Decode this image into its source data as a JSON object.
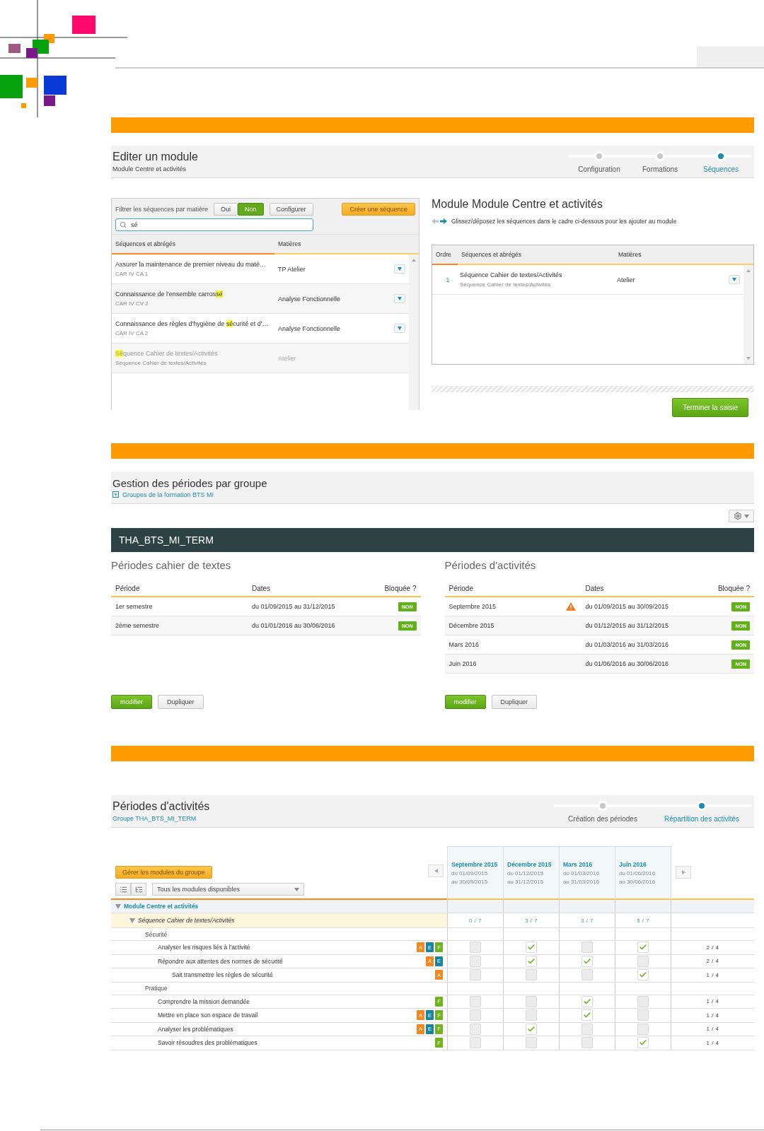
{
  "module_editor": {
    "title": "Editer un module",
    "subtitle": "Module Centre et activités",
    "steps": [
      {
        "label": "Configuration",
        "selected": false
      },
      {
        "label": "Formations",
        "selected": false
      },
      {
        "label": "Séquences",
        "selected": true
      }
    ],
    "filter": {
      "label": "Filtrer les séquences par matière",
      "options": [
        {
          "label": "Oui",
          "selected": false
        },
        {
          "label": "Non",
          "selected": true
        }
      ]
    },
    "configure_button": "Configurer",
    "create_button": "Créer une séquence",
    "search": {
      "value": "sé"
    },
    "columns": [
      "Séquences et abrégés",
      "Matières"
    ],
    "sequences": [
      {
        "title": {
          "pre": "Assurer la maintenance de premier niveau du maté…"
        },
        "code": "CAR IV CA 1",
        "subject": "TP Atelier",
        "added": false
      },
      {
        "title": {
          "pre": "Connaissance de l'ensemble carros",
          "match": "sé"
        },
        "code": "CAR IV CV 2",
        "subject": "Analyse Fonctionnelle",
        "added": false
      },
      {
        "title": {
          "pre": "Connaissance des règles d'hygiène de ",
          "match": "sé",
          "post": "curité et d'…"
        },
        "code": "CAR IV CA 2",
        "subject": "Analyse Fonctionnelle",
        "added": false
      },
      {
        "title": {
          "match": "Sé",
          "post": "quence Cahier de textes/Activités"
        },
        "code": "Séquence Cahier de textes/Activités",
        "subject": "Atelier",
        "added": true
      }
    ],
    "module_title": "Module Module Centre et activités",
    "hint": "Glissez/déposez les séquences dans le cadre ci-dessous pour les ajouter au module",
    "module_columns": [
      "Ordre",
      "Séquences et abrégés",
      "Matières"
    ],
    "module_sequences": [
      {
        "order": "1",
        "title": "Séquence Cahier de textes/Activités",
        "code": "Séquence Cahier de textes/Activités",
        "subject": "Atelier"
      }
    ],
    "finish_button": "Terminer la saisie"
  },
  "period_management": {
    "title": "Gestion des périodes par groupe",
    "link": "Groupes de la formation BTS MI",
    "group": "THA_BTS_MI_TERM",
    "panels": [
      {
        "title": "Périodes cahier de textes",
        "columns": [
          "Période",
          "Dates",
          "Bloquée ?"
        ],
        "rows": [
          {
            "period": "1er semestre",
            "warning": false,
            "dates": "du 01/09/2015 au 31/12/2015",
            "blocked": "NON"
          },
          {
            "period": "2ème semestre",
            "warning": false,
            "dates": "du 01/01/2016 au 30/06/2016",
            "blocked": "NON"
          }
        ],
        "buttons": [
          {
            "label": "modifier",
            "kind": "primary"
          },
          {
            "label": "Dupliquer",
            "kind": "default"
          }
        ]
      },
      {
        "title": "Périodes d'activités",
        "columns": [
          "Période",
          "Dates",
          "Bloquée ?"
        ],
        "rows": [
          {
            "period": "Septembre 2015",
            "warning": true,
            "dates": "du 01/09/2015 au 30/09/2015",
            "blocked": "NON"
          },
          {
            "period": "Décembre 2015",
            "warning": false,
            "dates": "du 01/12/2015 au 31/12/2015",
            "blocked": "NON"
          },
          {
            "period": "Mars 2016",
            "warning": false,
            "dates": "du 01/03/2016 au 31/03/2016",
            "blocked": "NON"
          },
          {
            "period": "Juin 2016",
            "warning": false,
            "dates": "du 01/06/2016 au 30/06/2016",
            "blocked": "NON"
          }
        ],
        "buttons": [
          {
            "label": "modifier",
            "kind": "primary"
          },
          {
            "label": "Dupliquer",
            "kind": "default"
          }
        ]
      }
    ]
  },
  "activity_periods": {
    "title": "Périodes d'activités",
    "subtitle": "Groupe THA_BTS_MI_TERM",
    "steps": [
      {
        "label": "Création des périodes",
        "selected": false
      },
      {
        "label": "Répartition des activités",
        "selected": true
      }
    ],
    "manage_button": "Gérer les modules du groupe",
    "module_filter": "Tous les modules disponibles",
    "periods": [
      {
        "name": "Septembre 2015",
        "from": "du 01/09/2015",
        "to": "au 30/09/2015"
      },
      {
        "name": "Décembre 2015",
        "from": "du 01/12/2015",
        "to": "au 31/12/2015"
      },
      {
        "name": "Mars 2016",
        "from": "du 01/03/2016",
        "to": "au 31/03/2016"
      },
      {
        "name": "Juin 2016",
        "from": "du 01/06/2016",
        "to": "au 30/06/2016"
      }
    ],
    "tree": [
      {
        "kind": "module",
        "label": "Module Centre et activités",
        "expanded": true,
        "children": [
          {
            "kind": "sequence",
            "label": "Séquence Cahier de textes/Activités",
            "expanded": true,
            "counts": [
              "0 / 7",
              "3 / 7",
              "3 / 7",
              "3 / 7"
            ],
            "children": [
              {
                "kind": "group",
                "label": "Sécurité",
                "children": [
                  {
                    "kind": "activity",
                    "label": "Analyser les risques liés à l'activité",
                    "tags": [
                      {
                        "label": "A",
                        "color": "#f7861c"
                      },
                      {
                        "label": "E",
                        "color": "#17869c"
                      },
                      {
                        "label": "F",
                        "color": "#6fb41c"
                      }
                    ],
                    "checks": [
                      false,
                      true,
                      false,
                      true
                    ],
                    "total": "2 / 4"
                  },
                  {
                    "kind": "activity",
                    "label": "Répondre aux attentes des normes de sécurité",
                    "tags": [
                      {
                        "label": "A",
                        "color": "#f7861c"
                      },
                      {
                        "label": "E",
                        "color": "#17869c"
                      }
                    ],
                    "checks": [
                      false,
                      true,
                      true,
                      false
                    ],
                    "total": "2 / 4",
                    "children": [
                      {
                        "kind": "activity",
                        "label": "Sait transmettre les règles de sécurité",
                        "tags": [
                          {
                            "label": "A",
                            "color": "#f7861c"
                          }
                        ],
                        "checks": [
                          false,
                          false,
                          false,
                          true
                        ],
                        "total": "1 / 4"
                      }
                    ]
                  }
                ]
              },
              {
                "kind": "group",
                "label": "Pratique",
                "children": [
                  {
                    "kind": "activity",
                    "label": "Comprendre la mission demandée",
                    "tags": [
                      {
                        "label": "F",
                        "color": "#6fb41c"
                      }
                    ],
                    "checks": [
                      false,
                      false,
                      true,
                      false
                    ],
                    "total": "1 / 4"
                  },
                  {
                    "kind": "activity",
                    "label": "Mettre en place son espace de travail",
                    "tags": [
                      {
                        "label": "A",
                        "color": "#f7861c"
                      },
                      {
                        "label": "E",
                        "color": "#17869c"
                      },
                      {
                        "label": "F",
                        "color": "#6fb41c"
                      }
                    ],
                    "checks": [
                      false,
                      false,
                      true,
                      false
                    ],
                    "total": "1 / 4"
                  },
                  {
                    "kind": "activity",
                    "label": "Analyser les problématiques",
                    "tags": [
                      {
                        "label": "A",
                        "color": "#f7861c"
                      },
                      {
                        "label": "E",
                        "color": "#17869c"
                      },
                      {
                        "label": "F",
                        "color": "#6fb41c"
                      }
                    ],
                    "checks": [
                      false,
                      true,
                      false,
                      false
                    ],
                    "total": "1 / 4"
                  },
                  {
                    "kind": "activity",
                    "label": "Savoir résoudres des problématiques",
                    "tags": [
                      {
                        "label": "F",
                        "color": "#6fb41c"
                      }
                    ],
                    "checks": [
                      false,
                      false,
                      false,
                      true
                    ],
                    "total": "1 / 4"
                  }
                ]
              }
            ]
          }
        ]
      }
    ]
  }
}
